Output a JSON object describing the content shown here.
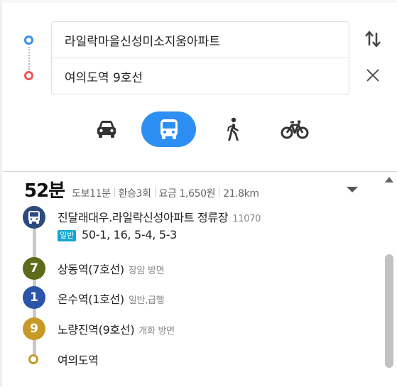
{
  "search": {
    "origin": "라일락마을신성미소지움아파트",
    "destination": "여의도역 9호선"
  },
  "modes": [
    {
      "icon": "car-icon",
      "active": false
    },
    {
      "icon": "bus-icon",
      "active": true
    },
    {
      "icon": "walk-icon",
      "active": false
    },
    {
      "icon": "bike-icon",
      "active": false
    }
  ],
  "summary": {
    "time": "52분",
    "walk": "도보11분",
    "transfers": "환승3회",
    "fare": "요금 1,650원",
    "distance": "21.8km"
  },
  "route": {
    "stops": [
      {
        "name": "진달래대우.라일락신성아파트 정류장",
        "sub": "11070",
        "marker": "bus-icon",
        "color": "#2c4a7d"
      },
      {
        "name": "상동역(7호선)",
        "sub": "장암 방면",
        "marker": "7",
        "color": "#5c6b1a"
      },
      {
        "name": "온수역(1호선)",
        "sub": "일반,급행",
        "marker": "1",
        "color": "#2a55a8"
      },
      {
        "name": "노량진역(9호선)",
        "sub": "개화 방면",
        "marker": "9",
        "color": "#c79a28"
      },
      {
        "name": "여의도역",
        "sub": "",
        "marker": "end-dot",
        "color": "#c79a28"
      }
    ],
    "bus_badge": "일반",
    "bus_lines": "50-1, 16, 5-4, 5-3"
  },
  "colors": {
    "accent": "#2d8ef3",
    "origin_dot": "#3a8ef0",
    "destination_dot": "#f0555a",
    "bus_badge": "#16a6cf"
  }
}
